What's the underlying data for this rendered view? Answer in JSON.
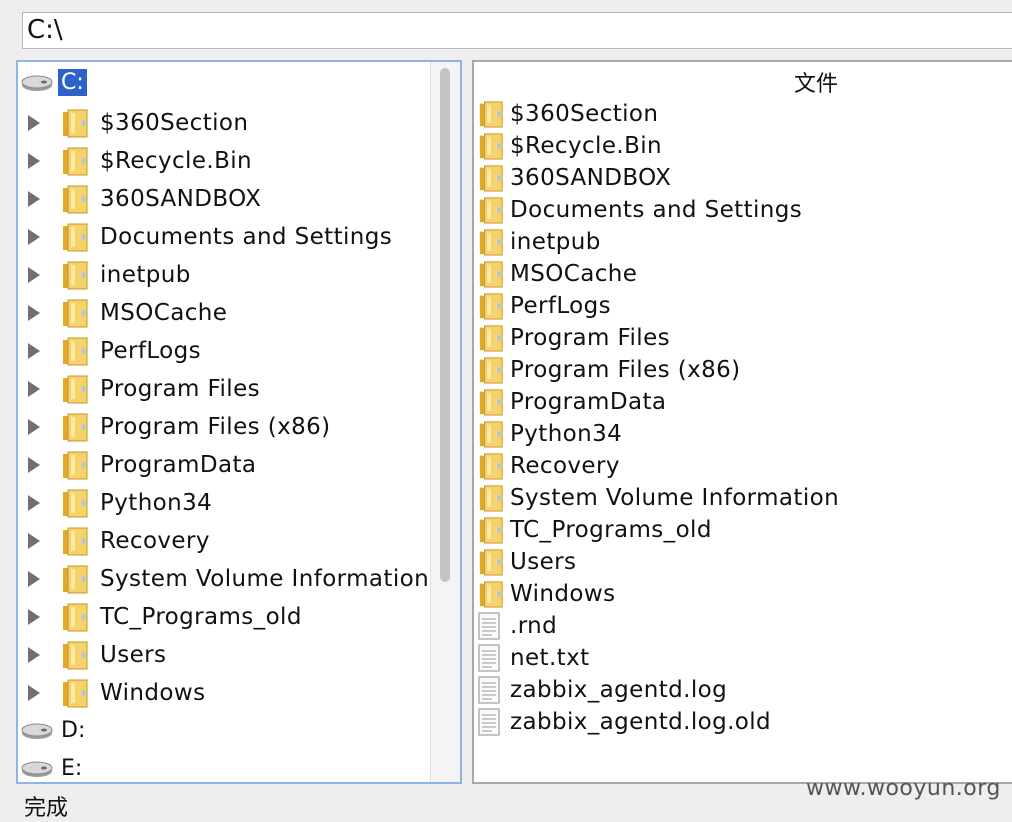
{
  "path_field": {
    "value": "C:\\"
  },
  "tree": {
    "drives": [
      {
        "label": "C:",
        "selected": true
      },
      {
        "label": "D:",
        "selected": false
      },
      {
        "label": "E:",
        "selected": false
      }
    ],
    "folders": [
      "$360Section",
      "$Recycle.Bin",
      "360SANDBOX",
      "Documents and Settings",
      "inetpub",
      "MSOCache",
      "PerfLogs",
      "Program Files",
      "Program Files (x86)",
      "ProgramData",
      "Python34",
      "Recovery",
      "System Volume Information",
      "TC_Programs_old",
      "Users",
      "Windows"
    ]
  },
  "list": {
    "header": "文件",
    "items": [
      {
        "name": "$360Section",
        "type": "folder"
      },
      {
        "name": "$Recycle.Bin",
        "type": "folder"
      },
      {
        "name": "360SANDBOX",
        "type": "folder"
      },
      {
        "name": "Documents and Settings",
        "type": "folder"
      },
      {
        "name": "inetpub",
        "type": "folder"
      },
      {
        "name": "MSOCache",
        "type": "folder"
      },
      {
        "name": "PerfLogs",
        "type": "folder"
      },
      {
        "name": "Program Files",
        "type": "folder"
      },
      {
        "name": "Program Files (x86)",
        "type": "folder"
      },
      {
        "name": "ProgramData",
        "type": "folder"
      },
      {
        "name": "Python34",
        "type": "folder"
      },
      {
        "name": "Recovery",
        "type": "folder"
      },
      {
        "name": "System Volume Information",
        "type": "folder"
      },
      {
        "name": "TC_Programs_old",
        "type": "folder"
      },
      {
        "name": "Users",
        "type": "folder"
      },
      {
        "name": "Windows",
        "type": "folder"
      },
      {
        "name": ".rnd",
        "type": "file"
      },
      {
        "name": "net.txt",
        "type": "file"
      },
      {
        "name": "zabbix_agentd.log",
        "type": "file"
      },
      {
        "name": "zabbix_agentd.log.old",
        "type": "file"
      }
    ]
  },
  "status": {
    "text": "完成"
  },
  "watermark": {
    "text": "www.wooyun.org"
  },
  "icons": {
    "drive": "hard-drive-icon",
    "folder": "folder-icon",
    "file": "text-file-icon",
    "expander": "expand-arrow-icon"
  },
  "colors": {
    "selection": "#2d63c8",
    "focus_border": "#8fb4e6",
    "folder": "#f2c94c"
  }
}
